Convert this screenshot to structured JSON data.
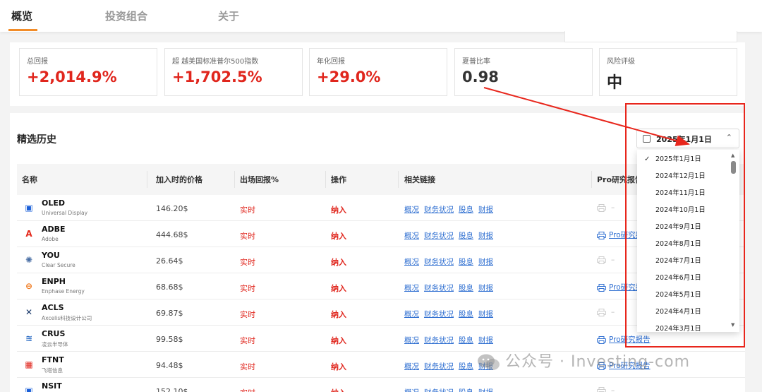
{
  "nav": {
    "tabs": [
      {
        "label": "概览",
        "active": true
      },
      {
        "label": "投资组合",
        "active": false
      },
      {
        "label": "关于",
        "active": false
      }
    ]
  },
  "stats": [
    {
      "label": "总回报",
      "value": "+2,014.9%",
      "color": "red"
    },
    {
      "label": "超 越美国标准普尔500指数",
      "value": "+1,702.5%",
      "color": "red"
    },
    {
      "label": "年化回报",
      "value": "+29.0%",
      "color": "red"
    },
    {
      "label": "夏普比率",
      "value": "0.98",
      "color": "dark"
    },
    {
      "label": "风险评级",
      "value": "中",
      "color": "dark"
    }
  ],
  "history": {
    "title": "精选历史",
    "columns": [
      "名称",
      "加入时的价格",
      "出场回报%",
      "操作",
      "相关链接",
      "Pro研究报告"
    ],
    "link_labels": [
      "概况",
      "财务状况",
      "股息",
      "财报"
    ],
    "rows": [
      {
        "ticker": "OLED",
        "company": "Universal Display",
        "price": "146.20$",
        "return": "实时",
        "action": "纳入",
        "pro_report": "",
        "logo_icon": "square-icon",
        "logo_color": "#1a5fd8"
      },
      {
        "ticker": "ADBE",
        "company": "Adobe",
        "price": "444.68$",
        "return": "实时",
        "action": "纳入",
        "pro_report": "Pro研究报告",
        "logo_icon": "adobe-a-icon",
        "logo_color": "#e4281b"
      },
      {
        "ticker": "YOU",
        "company": "Clear Secure",
        "price": "26.64$",
        "return": "实时",
        "action": "纳入",
        "pro_report": "",
        "logo_icon": "sun-icon",
        "logo_color": "#4a6fa5"
      },
      {
        "ticker": "ENPH",
        "company": "Enphase Energy",
        "price": "68.68$",
        "return": "实时",
        "action": "纳入",
        "pro_report": "Pro研究报告",
        "logo_icon": "circle-e-icon",
        "logo_color": "#f07a1f"
      },
      {
        "ticker": "ACLS",
        "company": "Axcelis科技设计公司",
        "price": "69.87$",
        "return": "实时",
        "action": "纳入",
        "pro_report": "",
        "logo_icon": "x-star-icon",
        "logo_color": "#1b3a6b"
      },
      {
        "ticker": "CRUS",
        "company": "凌云半导体",
        "price": "99.58$",
        "return": "实时",
        "action": "纳入",
        "pro_report": "Pro研究报告",
        "logo_icon": "wave-icon",
        "logo_color": "#2b6cc4"
      },
      {
        "ticker": "FTNT",
        "company": "飞塔信息",
        "price": "94.48$",
        "return": "实时",
        "action": "纳入",
        "pro_report": "Pro研究报告",
        "logo_icon": "grid-icon",
        "logo_color": "#e0261d"
      },
      {
        "ticker": "NSIT",
        "company": "",
        "price": "152.10$",
        "return": "实时",
        "action": "纳入",
        "pro_report": "",
        "logo_icon": "square-icon",
        "logo_color": "#1a5fd8"
      }
    ]
  },
  "date_select": {
    "selected": "2025年1月1日",
    "options": [
      "2025年1月1日",
      "2024年12月1日",
      "2024年11月1日",
      "2024年10月1日",
      "2024年9月1日",
      "2024年8月1日",
      "2024年7月1日",
      "2024年6月1日",
      "2024年5月1日",
      "2024年4月1日",
      "2024年3月1日"
    ]
  },
  "watermark": "公众号 · Investing-com",
  "colors": {
    "accent": "#f28c28",
    "up": "#e0261d",
    "link": "#2f6fd1",
    "annotation": "#e8261c"
  }
}
